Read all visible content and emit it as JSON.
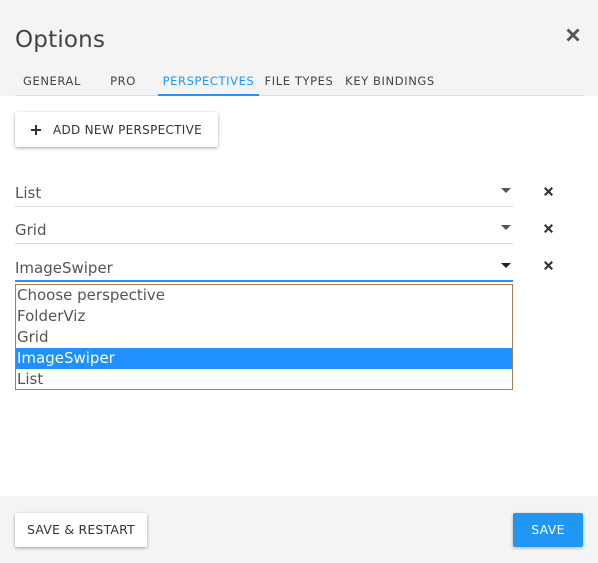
{
  "dialog": {
    "title": "Options"
  },
  "tabs": [
    {
      "label": "GENERAL",
      "active": false
    },
    {
      "label": "PRO",
      "active": false
    },
    {
      "label": "PERSPECTIVES",
      "active": true
    },
    {
      "label": "FILE TYPES",
      "active": false
    },
    {
      "label": "KEY BINDINGS",
      "active": false
    }
  ],
  "add_button": {
    "label": "ADD NEW PERSPECTIVE"
  },
  "perspectives": [
    {
      "label": "List"
    },
    {
      "label": "Grid"
    },
    {
      "label": "ImageSwiper"
    }
  ],
  "dropdown": {
    "options": [
      "Choose perspective",
      "FolderViz",
      "Grid",
      "ImageSwiper",
      "List"
    ],
    "selected": "ImageSwiper"
  },
  "footer": {
    "restart_label": "SAVE & RESTART",
    "save_label": "SAVE"
  },
  "colors": {
    "accent": "#2196f3",
    "selected_option": "#1e90ff",
    "dropdown_border": "#a67c52",
    "header_bg": "#f4f4f4"
  },
  "icons": {
    "close": "close-icon",
    "add": "plus-icon",
    "expand": "caret-down-icon",
    "remove": "remove-icon"
  }
}
